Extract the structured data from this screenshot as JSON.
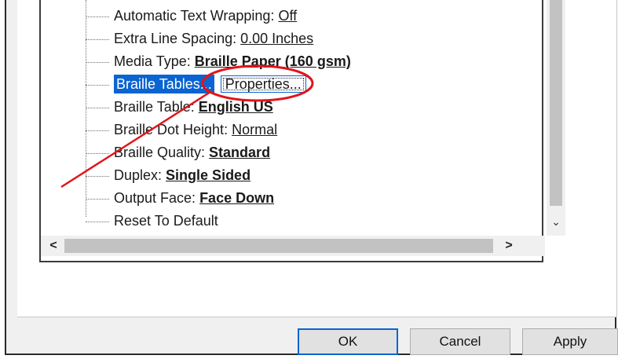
{
  "tree": {
    "items": [
      {
        "label": "Automatic Text Wrapping: ",
        "value": "Off",
        "bold": false
      },
      {
        "label": "Extra Line Spacing: ",
        "value": "0.00 Inches",
        "bold": false
      },
      {
        "label": "Media Type: ",
        "value": "Braille Paper (160 gsm)",
        "bold": true
      },
      {
        "label": "Braille Tables...",
        "value": "",
        "bold": false,
        "selected": true
      },
      {
        "label": "Braille Table: ",
        "value": "English US",
        "bold": true
      },
      {
        "label": "Braille Dot Height: ",
        "value": "Normal",
        "bold": false
      },
      {
        "label": "Braille Quality: ",
        "value": "Standard",
        "bold": true
      },
      {
        "label": "Duplex: ",
        "value": "Single Sided",
        "bold": true
      },
      {
        "label": "Output Face: ",
        "value": "Face Down",
        "bold": true
      },
      {
        "label": "Reset To Default",
        "value": "",
        "bold": false
      }
    ],
    "properties_button": "Properties..."
  },
  "scroll": {
    "down_arrow": "⌄",
    "left_arrow": "<",
    "right_arrow": ">"
  },
  "buttons": {
    "ok": "OK",
    "cancel": "Cancel",
    "apply": "Apply"
  },
  "colors": {
    "selection": "#0a64d2",
    "annotation": "#e0151b"
  },
  "icons": [
    "chevron-down-icon",
    "chevron-left-icon",
    "chevron-right-icon"
  ]
}
